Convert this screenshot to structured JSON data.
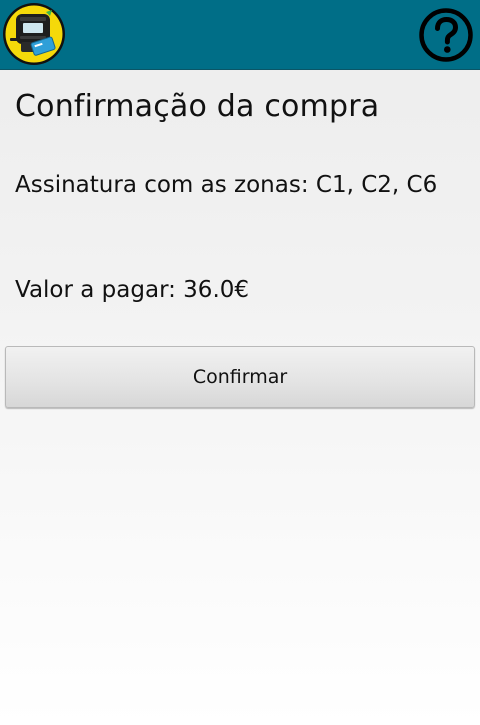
{
  "app_bar": {
    "background_color": "#006e87",
    "app_icon": "validator-card-icon",
    "help_icon": "help-question-icon"
  },
  "main": {
    "title": "Confirmação da compra",
    "zones_text": "Assinatura com as zonas: C1, C2, C6",
    "price_text": "Valor a pagar: 36.0€",
    "confirm_button_label": "Confirmar"
  }
}
